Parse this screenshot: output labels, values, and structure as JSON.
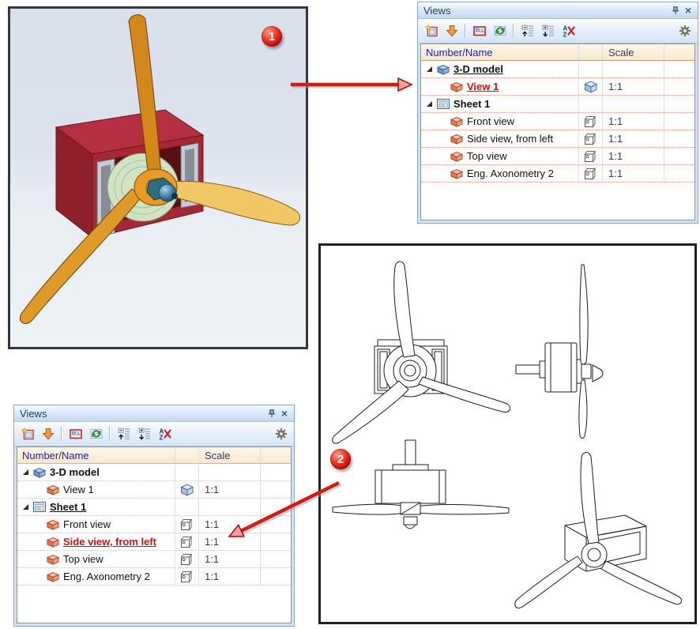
{
  "badges": {
    "b1": "1",
    "b2": "2"
  },
  "chrome": {
    "close_glyph": "×",
    "pin_icon": "pin-icon",
    "close_icon": "close-icon"
  },
  "toolbar_icons": [
    "create-view",
    "insert-view",
    "view-parameters",
    "update-views",
    "move-up",
    "move-down",
    "cancel-sort",
    "settings-gear"
  ],
  "colors": {
    "accent_red": "#d21b12",
    "active_text": "#cc1111",
    "header_text": "#21219b",
    "panel_blue": "#d3e2f4",
    "header_peach": "#f8e8cf"
  },
  "views_panel_top": {
    "title": "Views",
    "columns": {
      "name": "Number/Name",
      "scale": "Scale"
    },
    "rows": [
      {
        "label": "3-D model",
        "scale": "",
        "icon": "model-3d-cube-icon"
      },
      {
        "label": "View 1",
        "scale": "1:1",
        "icon": "view-cube-icon",
        "scale_icon": "cube-3d-icon"
      },
      {
        "label": "Sheet 1",
        "scale": "",
        "icon": "sheet-icon"
      },
      {
        "label": "Front view",
        "scale": "1:1",
        "icon": "view-cube-icon",
        "scale_icon": "projection-cube-icon"
      },
      {
        "label": "Side view, from left",
        "scale": "1:1",
        "icon": "view-cube-icon",
        "scale_icon": "projection-cube-icon"
      },
      {
        "label": "Top view",
        "scale": "1:1",
        "icon": "view-cube-icon",
        "scale_icon": "projection-cube-icon"
      },
      {
        "label": "Eng. Axonometry 2",
        "scale": "1:1",
        "icon": "view-cube-icon",
        "scale_icon": "projection-cube-icon"
      }
    ]
  },
  "views_panel_bottom": {
    "title": "Views",
    "columns": {
      "name": "Number/Name",
      "scale": "Scale"
    },
    "rows": [
      {
        "label": "3-D model",
        "scale": "",
        "icon": "model-3d-cube-icon"
      },
      {
        "label": "View 1",
        "scale": "1:1",
        "icon": "view-cube-icon",
        "scale_icon": "cube-3d-icon"
      },
      {
        "label": "Sheet 1",
        "scale": "",
        "icon": "sheet-icon"
      },
      {
        "label": "Front view",
        "scale": "1:1",
        "icon": "view-cube-icon",
        "scale_icon": "projection-cube-icon"
      },
      {
        "label": "Side view, from left",
        "scale": "1:1",
        "icon": "view-cube-icon",
        "scale_icon": "projection-cube-icon"
      },
      {
        "label": "Top view",
        "scale": "1:1",
        "icon": "view-cube-icon",
        "scale_icon": "projection-cube-icon"
      },
      {
        "label": "Eng. Axonometry 2",
        "scale": "1:1",
        "icon": "view-cube-icon",
        "scale_icon": "projection-cube-icon"
      }
    ]
  }
}
